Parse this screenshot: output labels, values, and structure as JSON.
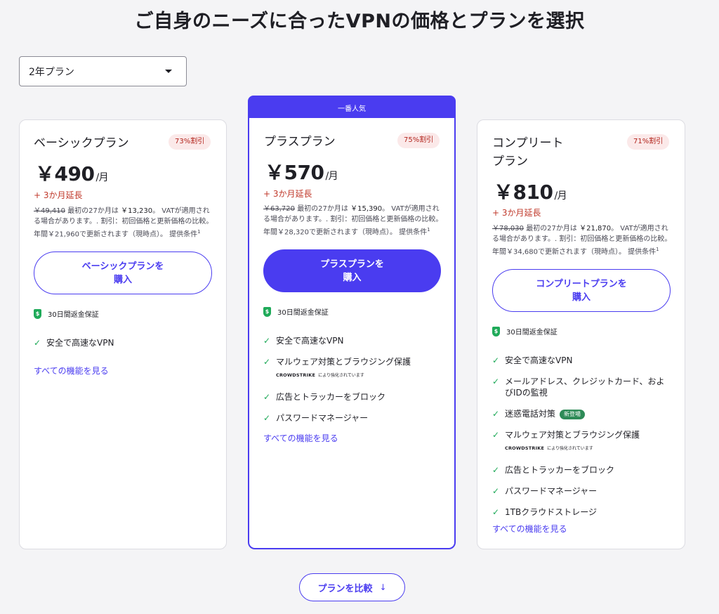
{
  "title": "ご自身のニーズに合ったVPNの価格とプランを選択",
  "period_select": {
    "value": "2年プラン"
  },
  "featured_banner": "一番人気",
  "plans": [
    {
      "name_line1": "ベーシックプラン",
      "name_line2": "",
      "discount": "73%割引",
      "price": "￥490",
      "per": "/月",
      "bonus": "+ 3か月延長",
      "old_price": "￥49,410",
      "first_term": "最初の27か月は",
      "first_price": "￥13,230",
      "fine_rest": "。 VATが適用される場合があります。. 割引：初回価格と更新価格の比較。年間￥21,960で更新されます（現時点）。 提供条件",
      "button_line1": "ベーシックプランを",
      "button_line2": "購入",
      "guarantee": "30日間返金保証",
      "features": [
        "安全で高速なVPN"
      ],
      "see_all": "すべての機能を見る"
    },
    {
      "name_line1": "プラスプラン",
      "name_line2": "",
      "discount": "75%割引",
      "price": "￥570",
      "per": "/月",
      "bonus": "+ 3か月延長",
      "old_price": "￥63,720",
      "first_term": "最初の27か月は",
      "first_price": "￥15,390",
      "fine_rest": "。 VATが適用される場合があります。. 割引：初回価格と更新価格の比較。年間￥28,320で更新されます（現時点）。 提供条件",
      "button_line1": "プラスプランを",
      "button_line2": "購入",
      "guarantee": "30日間返金保証",
      "features": [
        "安全で高速なVPN",
        "マルウェア対策とブラウジング保護",
        "広告とトラッカーをブロック",
        "パスワードマネージャー"
      ],
      "see_all": "すべての機能を見る"
    },
    {
      "name_line1": "コンプリート",
      "name_line2": "プラン",
      "discount": "71%割引",
      "price": "￥810",
      "per": "/月",
      "bonus": "+ 3か月延長",
      "old_price": "￥78,030",
      "first_term": "最初の27か月は",
      "first_price": "￥21,870",
      "fine_rest": "。 VATが適用される場合があります。. 割引：初回価格と更新価格の比較。年間￥34,680で更新されます（現時点）。 提供条件",
      "button_line1": "コンプリートプランを",
      "button_line2": "購入",
      "guarantee": "30日間返金保証",
      "features": [
        "安全で高速なVPN",
        "メールアドレス、クレジットカード、およびIDの監視",
        "迷惑電話対策",
        "マルウェア対策とブラウジング保護",
        "広告とトラッカーをブロック",
        "パスワードマネージャー",
        "1TBクラウドストレージ"
      ],
      "see_all": "すべての機能を見る"
    }
  ],
  "footnote_mark": "1",
  "new_badge": "新登場",
  "powered_brand": "CROWDSTRIKE",
  "powered_text": "により強化されています",
  "compare_button": "プランを比較",
  "compare_arrow": "↓",
  "colors": {
    "accent": "#4a3cf0",
    "discount_bg": "#fbe9e9",
    "discount_text": "#b3261e",
    "check": "#1faa59"
  },
  "icons": {
    "guarantee": "shield-dollar-icon",
    "feature": "check-icon",
    "select": "caret-down-icon",
    "compare": "arrow-down-icon"
  }
}
